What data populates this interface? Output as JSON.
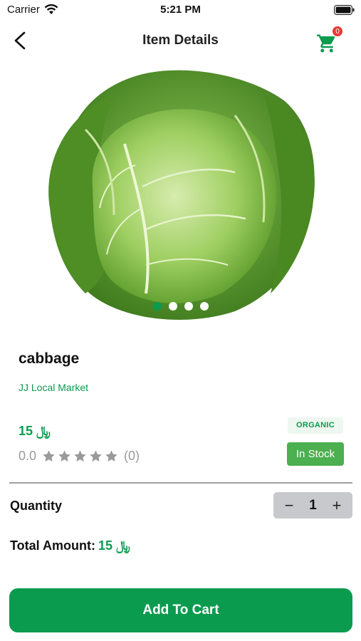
{
  "status_bar": {
    "carrier": "Carrier",
    "time": "5:21 PM",
    "wifi_icon": "wifi-icon",
    "battery_icon": "battery-icon"
  },
  "nav": {
    "title": "Item Details",
    "back_icon": "chevron-left-icon",
    "cart_icon": "shopping-cart-icon",
    "cart_badge": "0"
  },
  "gallery": {
    "image": "cabbage",
    "page_count": 4,
    "active_index": 0
  },
  "product": {
    "name": "cabbage",
    "store": "JJ Local Market",
    "price": "15 ﷼",
    "rating_value": "0.0",
    "rating_stars": 0,
    "rating_max": 5,
    "rating_count": "(0)",
    "tag": "ORGANIC",
    "stock_status": "In Stock"
  },
  "quantity": {
    "label": "Quantity",
    "minus": "−",
    "value": "1",
    "plus": "+"
  },
  "total": {
    "label": "Total Amount:",
    "value": "15 ﷼"
  },
  "actions": {
    "add_to_cart": "Add To Cart"
  },
  "colors": {
    "accent": "#0b9b4f",
    "in_stock": "#4caf50",
    "badge": "#e53935",
    "star_empty": "#9a9a9a"
  }
}
